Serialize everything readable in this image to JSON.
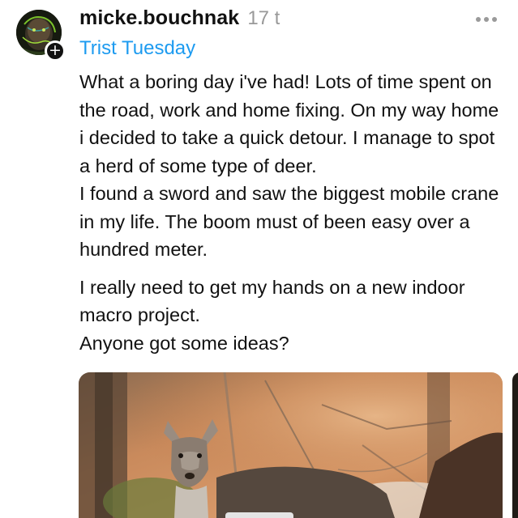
{
  "post": {
    "author": {
      "username": "micke.bouchnak",
      "timestamp": "17 t",
      "avatar_icon": "profile-photo",
      "follow_badge": "+"
    },
    "topic": "Trist Tuesday",
    "menu_icon": "more-dots-icon",
    "paragraphs": [
      "What a boring day i've had! Lots of time spent on the road, work and home fixing. On my way home i decided to take a quick detour. I manage to spot a herd of some type of deer.",
      "I found a sword and saw the biggest mobile crane in my life. The boom must of been easy over a hundred meter.",
      "I really need to get my hands on a new indoor macro project.",
      "Anyone got some ideas?"
    ],
    "media": {
      "description_icon": "deer-photo"
    }
  },
  "colors": {
    "text": "#111111",
    "secondary": "#999999",
    "topic_link": "#1d9bf0",
    "background": "#ffffff"
  }
}
